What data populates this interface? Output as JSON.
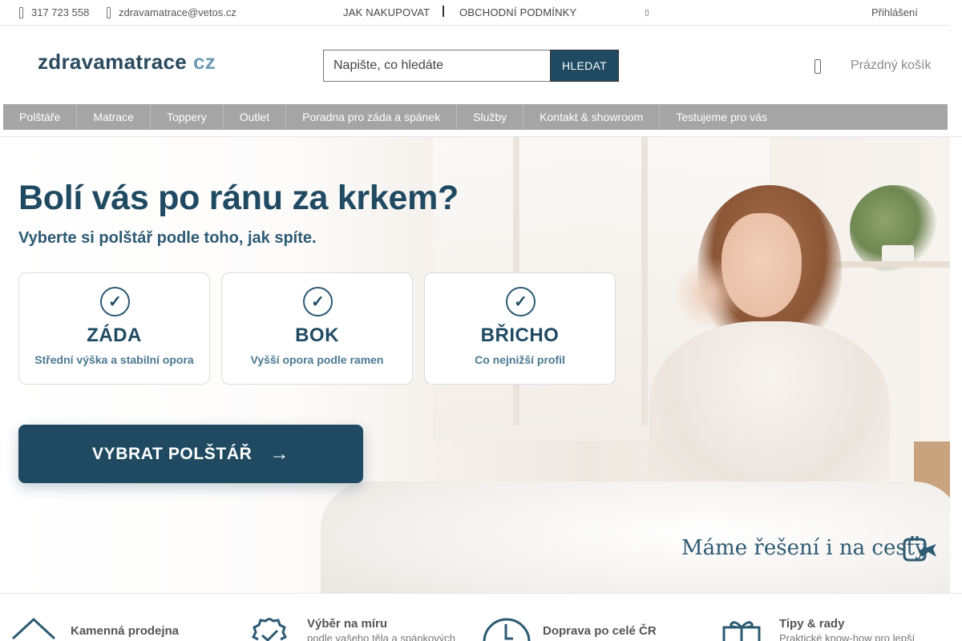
{
  "topbar": {
    "phone": "317 723 558",
    "email": "zdravamatrace@vetos.cz",
    "links": [
      "JAK NAKUPOVAT",
      "OBCHODNÍ PODMÍNKY"
    ],
    "login": "Přihlášení"
  },
  "header": {
    "logo_main": "zdravamatrace",
    "logo_tld": "cz",
    "search_placeholder": "Napište, co hledáte",
    "search_button": "HLEDAT",
    "cart": "Prázdný košík"
  },
  "nav": {
    "items": [
      "Polštáře",
      "Matrace",
      "Toppery",
      "Outlet",
      "Poradna pro záda a spánek",
      "Služby",
      "Kontakt & showroom",
      "Testujeme pro vás"
    ]
  },
  "hero": {
    "title": "Bolí vás po ránu za krkem?",
    "subtitle": "Vyberte si polštář podle toho, jak spíte.",
    "check_glyph": "✓",
    "cards": [
      {
        "title": "ZÁDA",
        "desc": "Střední výška a stabilní opora"
      },
      {
        "title": "BOK",
        "desc": "Vyšší opora podle ramen"
      },
      {
        "title": "BŘICHO",
        "desc": "Co nejnižší profil"
      }
    ],
    "cta_label": "VYBRAT POLŠTÁŘ",
    "cta_arrow": "→",
    "travel_text": "Máme řešení i na cesty",
    "travel_icon": "pillow-plane-icon"
  },
  "benefits": [
    {
      "title": "Kamenná prodejna",
      "subtitle": "",
      "icon": "house-icon"
    },
    {
      "title": "Výběr na míru",
      "subtitle": "podle vašeho těla a spánkových",
      "icon": "badge-check-icon"
    },
    {
      "title": "Doprava po celé ČR",
      "subtitle": "",
      "icon": "clock-icon"
    },
    {
      "title": "Tipy & rady",
      "subtitle": "Praktické know-how pro lepší",
      "icon": "gift-icon"
    }
  ],
  "colors": {
    "brand_dark": "#1f4a62",
    "brand_light": "#6f9bb5",
    "nav_bg": "#a5a5a5"
  }
}
